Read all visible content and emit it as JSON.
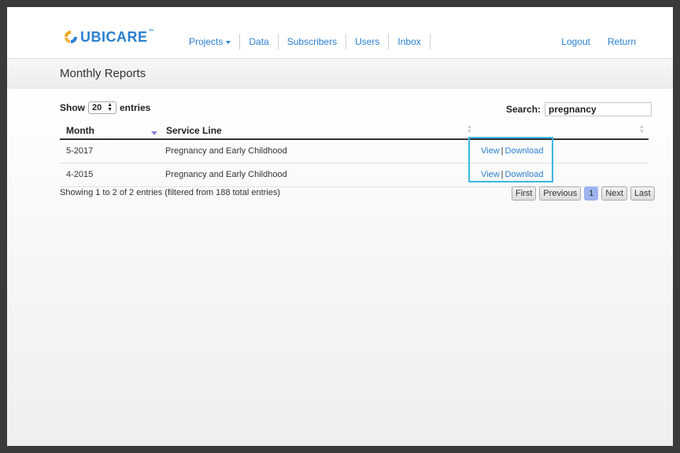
{
  "brand": {
    "logo_ubi": "Ubi",
    "logo_care": "Care",
    "logo_tm": "™"
  },
  "nav": {
    "items": [
      {
        "label": "Projects",
        "has_dropdown": true
      },
      {
        "label": "Data"
      },
      {
        "label": "Subscribers"
      },
      {
        "label": "Users"
      },
      {
        "label": "Inbox"
      }
    ],
    "logout": "Logout",
    "return": "Return"
  },
  "page": {
    "title": "Monthly Reports"
  },
  "table_controls": {
    "show_label": "Show",
    "entries_value": "20",
    "entries_label": "entries",
    "search_label": "Search:",
    "search_value": "pregnancy"
  },
  "table": {
    "columns": [
      "Month",
      "Service Line",
      ""
    ],
    "rows": [
      {
        "month": "5-2017",
        "service_line": "Pregnancy and Early Childhood",
        "view": "View",
        "separator": "|",
        "download": "Download"
      },
      {
        "month": "4-2015",
        "service_line": "Pregnancy and Early Childhood",
        "view": "View",
        "separator": "|",
        "download": "Download"
      }
    ]
  },
  "info": "Showing 1 to 2 of 2 entries (filtered from 188 total entries)",
  "pagination": {
    "first": "First",
    "previous": "Previous",
    "current": "1",
    "next": "Next",
    "last": "Last"
  },
  "colors": {
    "link": "#2a7fd0",
    "highlight": "#3fb6e2",
    "active_page": "#9fb4ef",
    "sort_arrow": "#8f7fd6",
    "logo_orange": "#f5a623"
  }
}
